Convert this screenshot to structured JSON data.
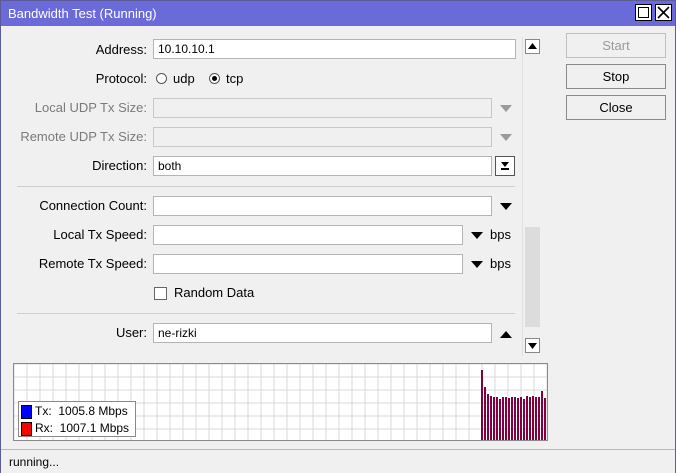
{
  "window": {
    "title": "Bandwidth Test (Running)"
  },
  "form": {
    "address": {
      "label": "Address:",
      "value": "10.10.10.1"
    },
    "protocol": {
      "label": "Protocol:",
      "options": [
        "udp",
        "tcp"
      ],
      "selected": "tcp"
    },
    "local_udp_tx_size": {
      "label": "Local UDP Tx Size:",
      "value": ""
    },
    "remote_udp_tx_size": {
      "label": "Remote UDP Tx Size:",
      "value": ""
    },
    "direction": {
      "label": "Direction:",
      "value": "both"
    },
    "connection_count": {
      "label": "Connection Count:",
      "value": ""
    },
    "local_tx_speed": {
      "label": "Local Tx Speed:",
      "value": "",
      "unit": "bps"
    },
    "remote_tx_speed": {
      "label": "Remote Tx Speed:",
      "value": "",
      "unit": "bps"
    },
    "random_data": {
      "label": "Random Data",
      "checked": false
    },
    "user": {
      "label": "User:",
      "value": "ne-rizki"
    }
  },
  "buttons": {
    "start": "Start",
    "stop": "Stop",
    "close": "Close"
  },
  "graph": {
    "tx": {
      "label": "Tx:",
      "value": "1005.8 Mbps",
      "color": "#0000ff"
    },
    "rx": {
      "label": "Rx:",
      "value": "1007.1 Mbps",
      "color": "#ff0000"
    },
    "bar_color": "#800040",
    "bar_levels": [
      0.95,
      0.72,
      0.62,
      0.6,
      0.58,
      0.58,
      0.56,
      0.58,
      0.58,
      0.57,
      0.58,
      0.58,
      0.57,
      0.58,
      0.55,
      0.59,
      0.58,
      0.6,
      0.58,
      0.58,
      0.66,
      0.57,
      0.58,
      0.62,
      0.58,
      0.6,
      0.58,
      0.56,
      0.58,
      0.6
    ]
  },
  "status": {
    "text": "running..."
  }
}
